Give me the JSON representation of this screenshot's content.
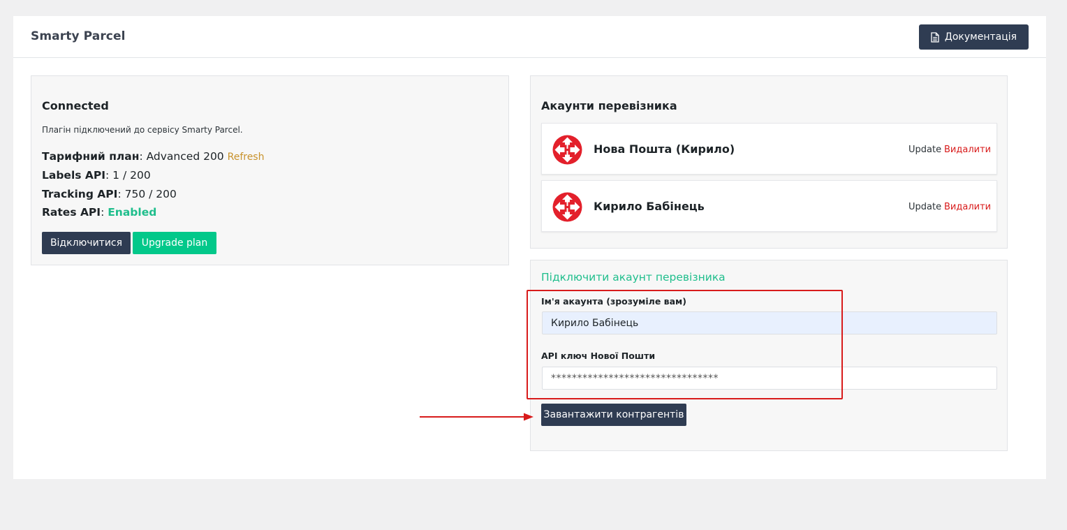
{
  "app": {
    "title": "Smarty Parcel"
  },
  "header": {
    "docs_label": "Документація",
    "docs_icon": "document-icon"
  },
  "status": {
    "title": "Connected",
    "description": "Плагін підключений до сервісу Smarty Parcel.",
    "plan_label": "Тарифний план",
    "plan_value": "Advanced 200",
    "refresh_label": "Refresh",
    "labels_api_label": "Labels API",
    "labels_api_value": "1 / 200",
    "tracking_api_label": "Tracking API",
    "tracking_api_value": "750 / 200",
    "rates_api_label": "Rates API",
    "rates_api_value": "Enabled",
    "disconnect_label": "Відключитися",
    "upgrade_label": "Upgrade plan"
  },
  "accounts": {
    "title": "Акаунти перевізника",
    "items": [
      {
        "name": "Нова Пошта (Кирило)",
        "update_label": "Update",
        "delete_label": "Видалити",
        "logo": "nova-poshta-logo"
      },
      {
        "name": "Кирило Бабінець",
        "update_label": "Update",
        "delete_label": "Видалити",
        "logo": "nova-poshta-logo"
      }
    ]
  },
  "connect": {
    "title": "Підключити акаунт перевізника",
    "name_label": "Ім'я акаунта (зрозуміле вам)",
    "name_value": "Кирило Бабінець",
    "key_label": "API ключ Нової Пошти",
    "key_value": "********************************",
    "submit_label": "Завантажити контрагентів"
  },
  "colors": {
    "primary_dark": "#2f3c52",
    "green": "#03c88a",
    "green_text": "#1fbe8c",
    "refresh": "#c8922b",
    "danger": "#d81b1b",
    "annotation": "#d81b1b"
  }
}
